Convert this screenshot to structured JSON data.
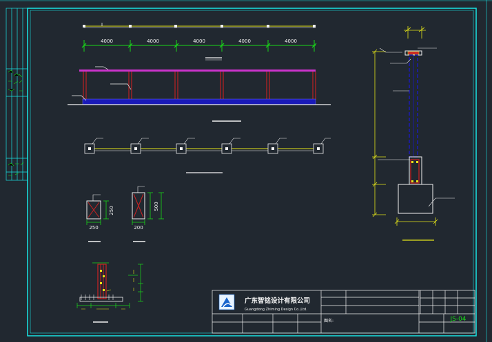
{
  "drawing": {
    "colors": {
      "background": "#212830",
      "frame": "#19e5e5",
      "dimension": "#19d919",
      "magenta": "#cc33cc",
      "red": "#cc2222",
      "blue": "#1a1ab8",
      "yellow": "#e6e619",
      "white": "#f2f2f2"
    },
    "spans": [
      "4000",
      "4000",
      "4000",
      "4000",
      "4000"
    ],
    "section_1": {
      "width": "250",
      "height": "250"
    },
    "section_2": {
      "width": "200",
      "height": "500"
    }
  },
  "title_block": {
    "company_cn": "广东智铭设计有限公司",
    "company_en": "Guangdong Zhiming Design Co.,Ltd.",
    "sheet_number": "JS-04",
    "field_label": "图名:"
  }
}
